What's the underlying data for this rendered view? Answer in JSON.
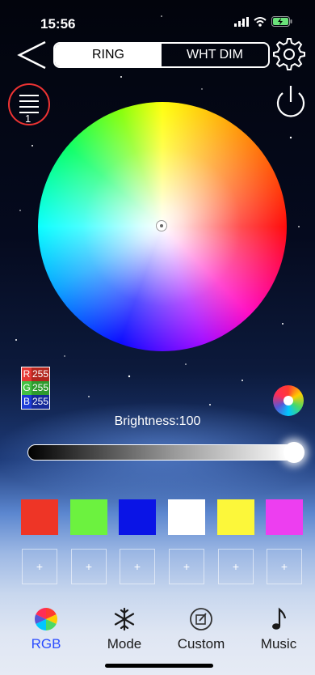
{
  "status": {
    "time": "15:56"
  },
  "header": {
    "tabs": [
      {
        "label": "RING",
        "active": true
      },
      {
        "label": "WHT DIM",
        "active": false
      }
    ]
  },
  "menu": {
    "count": "1"
  },
  "rgb": {
    "r_label": "R",
    "r_value": "255",
    "g_label": "G",
    "g_value": "255",
    "b_label": "B",
    "b_value": "255"
  },
  "brightness": {
    "label": "Brightness:100",
    "value": 100
  },
  "swatches": [
    "#ee3526",
    "#6cf23f",
    "#0a14e6",
    "#ffffff",
    "#fcf73a",
    "#ed3ef0"
  ],
  "custom_slots": [
    "+",
    "+",
    "+",
    "+",
    "+",
    "+"
  ],
  "tabbar": {
    "items": [
      {
        "label": "RGB",
        "icon": "color-wheel-icon",
        "active": true
      },
      {
        "label": "Mode",
        "icon": "snowflake-icon",
        "active": false
      },
      {
        "label": "Custom",
        "icon": "edit-icon",
        "active": false
      },
      {
        "label": "Music",
        "icon": "music-note-icon",
        "active": false
      }
    ]
  },
  "colors": {
    "accent": "#2b4cff",
    "menu_ring": "#e33333"
  }
}
